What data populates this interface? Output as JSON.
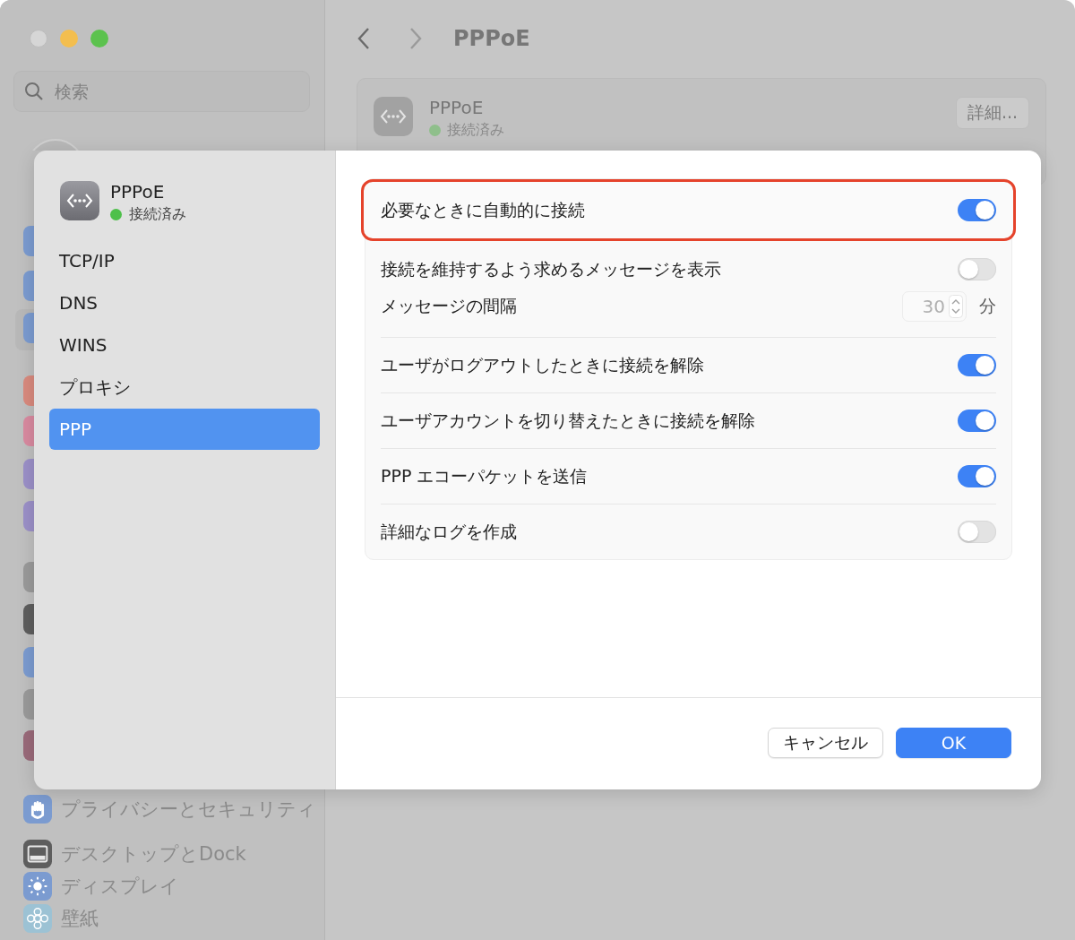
{
  "window": {
    "search": {
      "placeholder": "検索"
    },
    "sidebar_items": [
      {
        "label": "プライバシーとセキュリティ"
      },
      {
        "label": "デスクトップとDock"
      },
      {
        "label": "ディスプレイ"
      },
      {
        "label": "壁紙"
      }
    ],
    "title": "PPPoE",
    "service": {
      "name": "PPPoE",
      "status": "接続済み",
      "button": "詳細..."
    }
  },
  "sheet": {
    "header": {
      "name": "PPPoE",
      "status": "接続済み"
    },
    "nav": [
      {
        "label": "TCP/IP",
        "selected": false
      },
      {
        "label": "DNS",
        "selected": false
      },
      {
        "label": "WINS",
        "selected": false
      },
      {
        "label": "プロキシ",
        "selected": false
      },
      {
        "label": "PPP",
        "selected": true
      }
    ],
    "groups": [
      [
        {
          "kind": "toggle",
          "label": "必要なときに自動的に接続",
          "on": true,
          "highlighted": true
        }
      ],
      [
        {
          "kind": "toggle",
          "label": "接続を維持するよう求めるメッセージを表示",
          "on": false
        },
        {
          "kind": "stepper",
          "label": "メッセージの間隔",
          "value": "30",
          "unit": "分",
          "disabled": true
        }
      ],
      [
        {
          "kind": "toggle",
          "label": "ユーザがログアウトしたときに接続を解除",
          "on": true
        }
      ],
      [
        {
          "kind": "toggle",
          "label": "ユーザアカウントを切り替えたときに接続を解除",
          "on": true
        }
      ],
      [
        {
          "kind": "toggle",
          "label": "PPP エコーパケットを送信",
          "on": true
        }
      ],
      [
        {
          "kind": "toggle",
          "label": "詳細なログを作成",
          "on": false
        }
      ]
    ],
    "buttons": [
      {
        "label": "キャンセル",
        "kind": "secondary"
      },
      {
        "label": "OK",
        "kind": "primary"
      }
    ]
  }
}
